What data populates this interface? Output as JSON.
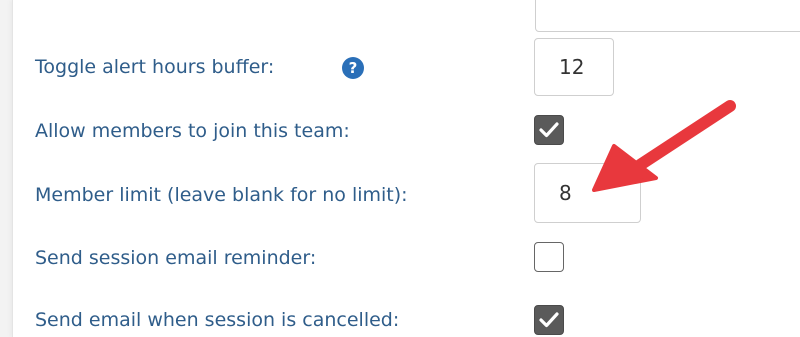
{
  "form": {
    "toggle_alert": {
      "label": "Toggle alert hours buffer:",
      "value": "12",
      "help_icon": "question-circle-icon"
    },
    "allow_join": {
      "label": "Allow members to join this team:",
      "checked": true
    },
    "member_limit": {
      "label": "Member limit (leave blank for no limit):",
      "value": "8"
    },
    "session_reminder": {
      "label": "Send session email reminder:",
      "checked": false
    },
    "cancel_email": {
      "label": "Send email when session is cancelled:",
      "checked": true
    }
  },
  "colors": {
    "label": "#2f5d8a",
    "help_icon": "#2a6fb8",
    "arrow": "#e8383d",
    "checkbox_checked": "#5a5a5a"
  },
  "annotation": {
    "type": "arrow",
    "points_to": "member-limit-input"
  }
}
